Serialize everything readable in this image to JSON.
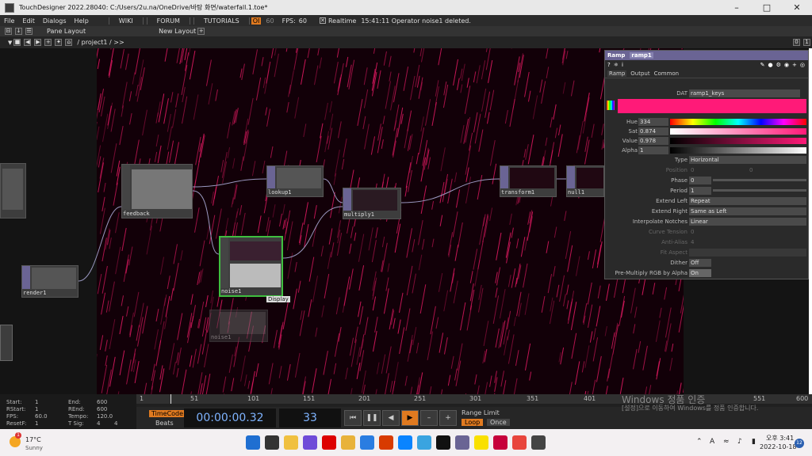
{
  "titlebar": {
    "title": "TouchDesigner 2022.28040: C:/Users/2u.na/OneDrive/바탕 화면/waterfall.1.toe*"
  },
  "menu": {
    "items": [
      "File",
      "Edit",
      "Dialogs",
      "Help"
    ],
    "tabs": [
      "WIKI",
      "FORUM",
      "TUTORIALS"
    ],
    "oi_badge": "OI",
    "fps_60a": "60",
    "fps_label": "FPS:",
    "fps_value": "60",
    "realtime_label": "Realtime",
    "status_message": "15:41:11 Operator noise1 deleted."
  },
  "panebar": {
    "pane_layout": "Pane Layout",
    "new_layout": "New Layout",
    "zero": "0",
    "one": "1"
  },
  "pathbar": {
    "path": "/ project1 / >>"
  },
  "nodes": {
    "feedback": "feedback",
    "lookup": "lookup1",
    "multiply": "multiply1",
    "transform": "transform1",
    "null": "null1",
    "render": "render1",
    "noise1": "noise1",
    "noise1b": "noise1",
    "display_tooltip": "Display"
  },
  "params": {
    "op_type": "Ramp",
    "op_name": "ramp1",
    "tabs": [
      "Ramp",
      "Output",
      "Common"
    ],
    "dat_label": "DAT",
    "dat_value": "ramp1_keys",
    "hue_label": "Hue",
    "hue_value": "334",
    "sat_label": "Sat",
    "sat_value": "0.874",
    "value_label": "Value",
    "value_value": "0.978",
    "alpha_label": "Alpha",
    "alpha_value": "1",
    "type_label": "Type",
    "type_value": "Horizontal",
    "position_label": "Position",
    "position_x": "0",
    "position_y": "0",
    "phase_label": "Phase",
    "phase_value": "0",
    "period_label": "Period",
    "period_value": "1",
    "extend_left_label": "Extend Left",
    "extend_left_value": "Repeat",
    "extend_right_label": "Extend Right",
    "extend_right_value": "Same as Left",
    "interp_label": "Interpolate Notches",
    "interp_value": "Linear",
    "curve_label": "Curve Tension",
    "curve_value": "0",
    "antialias_label": "Anti-Alias",
    "antialias_value": "4",
    "fitaspect_label": "Fit Aspect",
    "dither_label": "Dither",
    "dither_value": "Off",
    "premult_label": "Pre-Multiply RGB by Alpha",
    "premult_value": "On",
    "ramp_color": "#ff1a78"
  },
  "timeline": {
    "start_label": "Start:",
    "start_value": "1",
    "end_label": "End:",
    "end_value": "600",
    "rstart_label": "RStart:",
    "rstart_value": "1",
    "rend_label": "REnd:",
    "rend_value": "600",
    "fps_label": "FPS:",
    "fps_value": "60.0",
    "tempo_label": "Tempo:",
    "tempo_value": "120.0",
    "resetf_label": "ResetF:",
    "resetf_value": "1",
    "tsig_label": "T Sig:",
    "tsig_a": "4",
    "tsig_b": "4",
    "ruler_ticks": [
      "1",
      "51",
      "101",
      "151",
      "201",
      "251",
      "301",
      "351",
      "401",
      "551",
      "600"
    ],
    "timecode_label": "TimeCode",
    "beats_label": "Beats",
    "timecode": "00:00:00.32",
    "frame": "33",
    "range_limit_label": "Range Limit",
    "loop_label": "Loop",
    "once_label": "Once"
  },
  "watermark": {
    "line1": "Windows 정품 인증",
    "line2": "[설정]으로 이동하여 Windows를 정품 인증합니다."
  },
  "taskbar": {
    "temp": "17°C",
    "weather": "Sunny",
    "badge": "1",
    "time": "오후 3:41",
    "date": "2022-10-18",
    "notif": "12",
    "lang": "A",
    "icons": [
      "windows-icon",
      "search-icon",
      "file-explorer-icon",
      "chat-icon",
      "netflix-icon",
      "folder-icon",
      "mail-icon",
      "office-icon",
      "edge-icon",
      "photos-icon",
      "notion-icon",
      "touchdesigner-icon",
      "kakao-icon",
      "indesign-icon",
      "chrome-icon",
      "app-icon"
    ]
  },
  "colors": {
    "accent_orange": "#e07a20",
    "node_purple": "#6a6494",
    "selected_green": "#3fbf3f",
    "rain_pink": "#d8185e"
  }
}
